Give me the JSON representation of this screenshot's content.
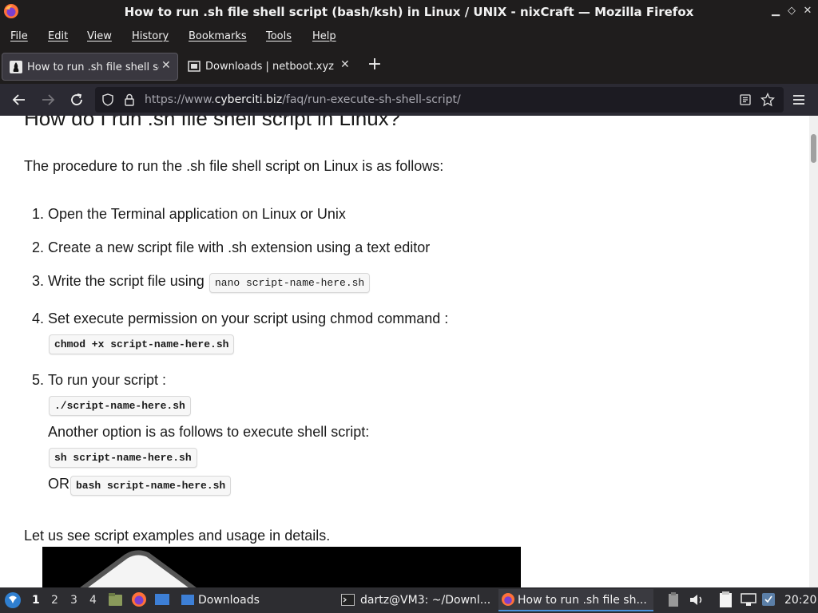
{
  "window": {
    "title": "How to run .sh file shell script (bash/ksh) in Linux / UNIX - nixCraft — Mozilla Firefox"
  },
  "menu": {
    "items": [
      "File",
      "Edit",
      "View",
      "History",
      "Bookmarks",
      "Tools",
      "Help"
    ]
  },
  "tabs": [
    {
      "label": "How to run .sh file shell script",
      "active": true
    },
    {
      "label": "Downloads | netboot.xyz",
      "active": false
    }
  ],
  "urlbar": {
    "prefix": "https://www.",
    "domain": "cyberciti.biz",
    "path": "/faq/run-execute-sh-shell-script/"
  },
  "article": {
    "heading": "How do I run .sh file shell script in Linux?",
    "intro": "The procedure to run the .sh file shell script on Linux is as follows:",
    "steps": [
      {
        "num": "1.",
        "text": "Open the Terminal application on Linux or Unix"
      },
      {
        "num": "2.",
        "text": "Create a new script file with .sh extension using a text editor"
      },
      {
        "num": "3.",
        "text": "Write the script file using",
        "code": "nano script-name-here.sh"
      },
      {
        "num": "4.",
        "text": "Set execute permission on your script using chmod command :",
        "code": "chmod +x script-name-here.sh"
      },
      {
        "num": "5.",
        "text": "To run your script :",
        "code": "./script-name-here.sh"
      }
    ],
    "another_option": "Another option is as follows to execute shell script:",
    "sh_code": "sh script-name-here.sh",
    "or_label": "OR",
    "bash_code": "bash script-name-here.sh",
    "outro": "Let us see script examples and usage in details."
  },
  "taskbar": {
    "workspaces": [
      "1",
      "2",
      "3",
      "4"
    ],
    "tasks": [
      {
        "label": "Downloads"
      },
      {
        "label": "dartz@VM3: ~/Downl..."
      },
      {
        "label": "How to run .sh file sh..."
      }
    ],
    "clock": "20:20"
  }
}
